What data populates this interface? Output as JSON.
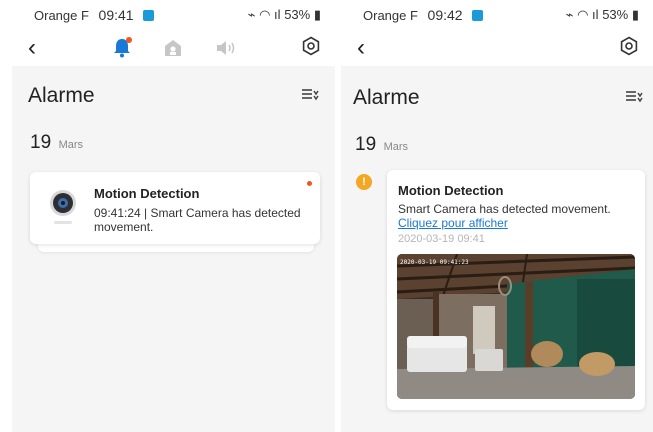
{
  "left_screen": {
    "status": {
      "carrier": "Orange F",
      "time": "09:41",
      "battery": "53%"
    },
    "toolbar": {
      "tab_icons": [
        "bell-icon",
        "home-icon",
        "speaker-icon"
      ],
      "notification_dot_color": "#f0571e"
    },
    "title": "Alarme",
    "date": {
      "day": "19",
      "month": "Mars"
    },
    "card": {
      "title": "Motion Detection",
      "message": "09:41:24 | Smart Camera has detected movement.",
      "unread": true
    }
  },
  "right_screen": {
    "status": {
      "carrier": "Orange F",
      "time": "09:42",
      "battery": "53%"
    },
    "title": "Alarme",
    "date": {
      "day": "19",
      "month": "Mars"
    },
    "card": {
      "title": "Motion Detection",
      "message": "Smart Camera has detected movement.",
      "link": "Cliquez pour afficher",
      "timestamp": "2020-03-19 09:41",
      "snapshot_overlay": "2020-03-19 09:41:23"
    }
  },
  "colors": {
    "accent_blue": "#1a79d6",
    "alert_orange": "#f5a623",
    "dot_red": "#f0571e"
  }
}
